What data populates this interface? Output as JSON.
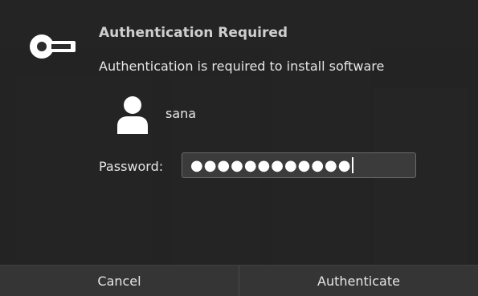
{
  "dialog": {
    "title": "Authentication Required",
    "message": "Authentication is required to install software",
    "icon": "key-icon",
    "user": {
      "name": "sana",
      "avatar_icon": "user-avatar-icon"
    },
    "password": {
      "label": "Password:",
      "masked_value": "●●●●●●●●●●●●"
    },
    "buttons": {
      "cancel_label": "Cancel",
      "authenticate_label": "Authenticate"
    }
  }
}
